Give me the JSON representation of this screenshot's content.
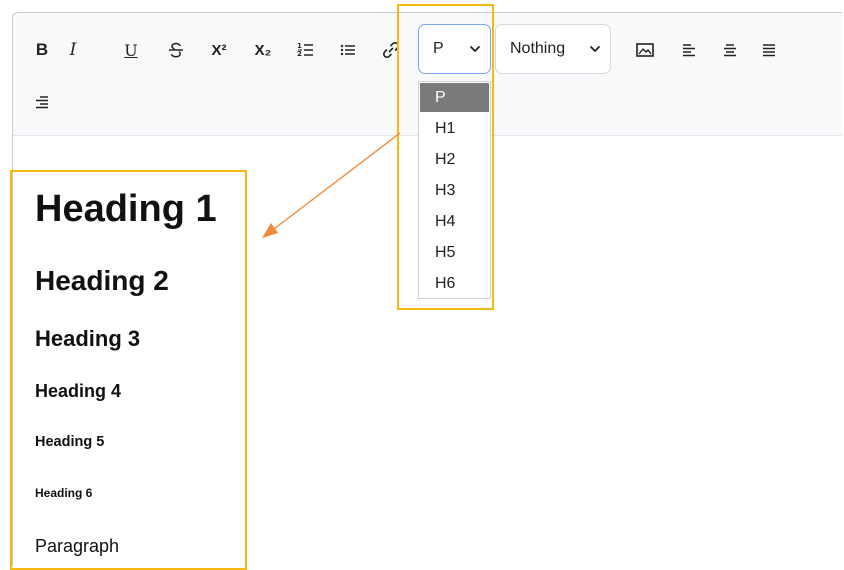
{
  "toolbar": {
    "buttons": {
      "bold": "B",
      "italic": "I",
      "underline": "U",
      "superscript": "X²",
      "subscript": "X₂"
    },
    "block_select": {
      "value": "P"
    },
    "font_select": {
      "value": "Nothing"
    },
    "block_options": [
      "P",
      "H1",
      "H2",
      "H3",
      "H4",
      "H5",
      "H6"
    ]
  },
  "content": {
    "h1": "Heading 1",
    "h2": "Heading 2",
    "h3": "Heading 3",
    "h4": "Heading 4",
    "h5": "Heading 5",
    "h6": "Heading 6",
    "p": "Paragraph"
  },
  "colors": {
    "highlight": "#f5b90f",
    "arrow": "#f08a3c",
    "active_option_bg": "#7a7a7a"
  }
}
